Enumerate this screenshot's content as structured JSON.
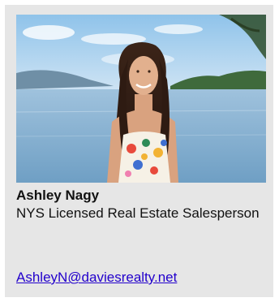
{
  "agent": {
    "name": "Ashley Nagy",
    "title": "NYS Licensed Real Estate Salesperson",
    "email": "AshleyN@daviesrealty.net"
  },
  "colors": {
    "card_background": "#e6e6e6",
    "link": "#2200cc",
    "text": "#111111"
  }
}
